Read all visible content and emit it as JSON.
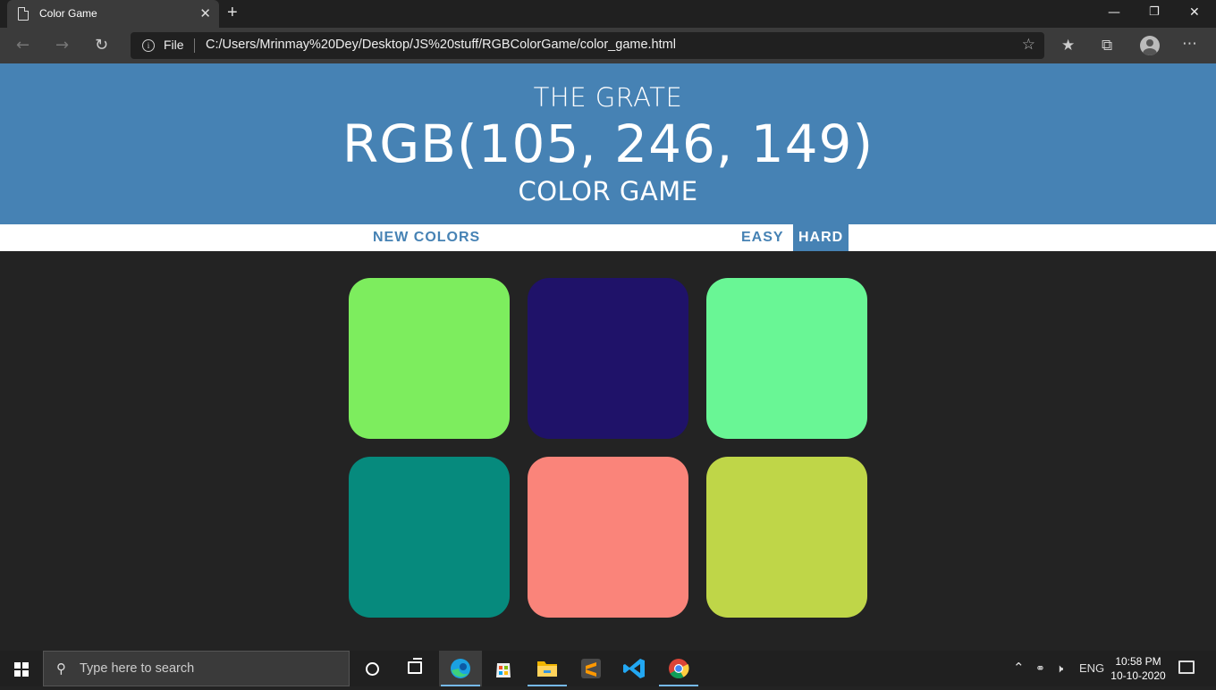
{
  "browser": {
    "tab_title": "Color Game",
    "tab_close": "✕",
    "new_tab": "+",
    "address_scheme_label": "File",
    "url": "C:/Users/Mrinmay%20Dey/Desktop/JS%20stuff/RGBColorGame/color_game.html",
    "icons": [
      "page-icon",
      "back-icon",
      "forward-icon",
      "refresh-icon",
      "info-icon",
      "favorite-star-icon",
      "favorites-icon",
      "collections-icon",
      "profile-icon",
      "more-icon",
      "minimize-icon",
      "restore-icon",
      "close-icon"
    ]
  },
  "game": {
    "header_line1": "THE GRATE",
    "target_color": "RGB(105, 246, 149)",
    "header_line3": "COLOR GAME",
    "header_bg": "#4682b4",
    "new_colors_label": "NEW COLORS",
    "easy_label": "EASY",
    "hard_label": "HARD",
    "selected_mode": "HARD",
    "squares": [
      {
        "color": "#7ded5e"
      },
      {
        "color": "#1f1269"
      },
      {
        "color": "#69f695"
      },
      {
        "color": "#068a7d"
      },
      {
        "color": "#fa847a"
      },
      {
        "color": "#bfd648"
      }
    ]
  },
  "taskbar": {
    "search_placeholder": "Type here to search",
    "apps": [
      "edge-icon",
      "store-icon",
      "file-explorer-icon",
      "sublime-text-icon",
      "vscode-icon",
      "chrome-icon"
    ],
    "active_app": "edge-icon",
    "language": "ENG",
    "time": "10:58 PM",
    "date": "10-10-2020"
  }
}
